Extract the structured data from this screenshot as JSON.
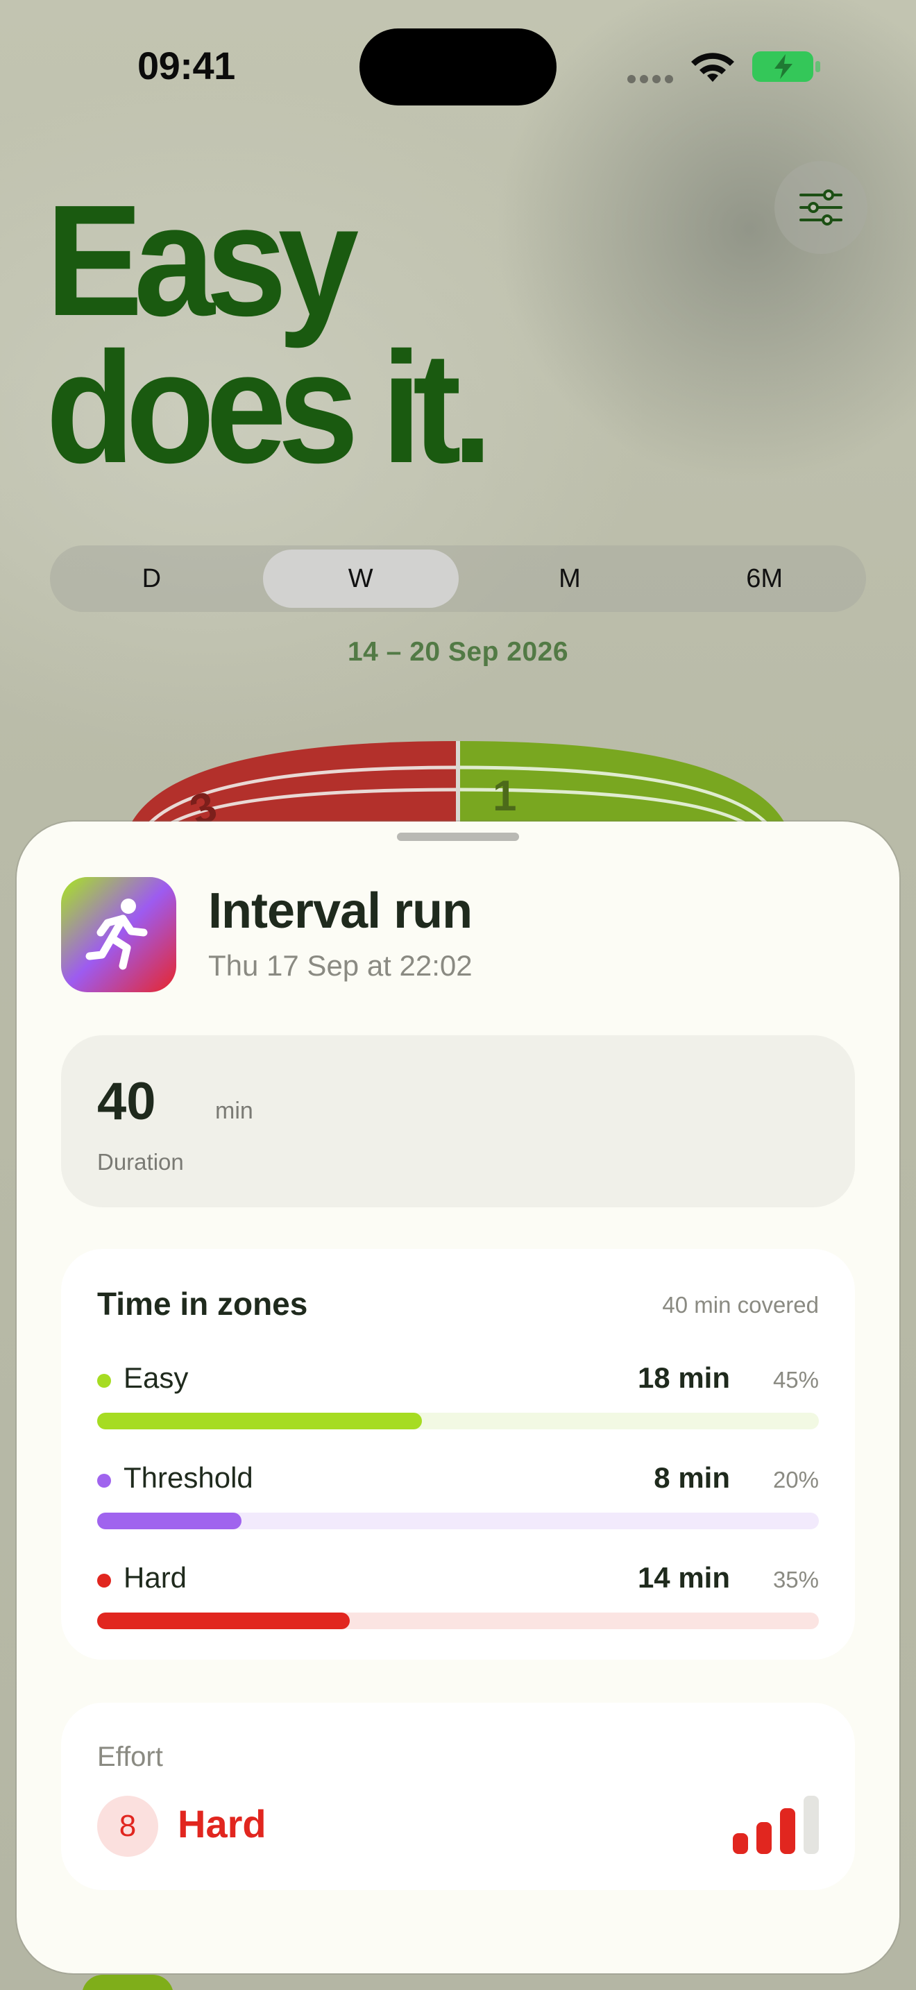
{
  "status_bar": {
    "time": "09:41"
  },
  "hero": {
    "line1": "Easy",
    "line2": "does it."
  },
  "segmented": {
    "items": [
      {
        "label": "D",
        "active": false
      },
      {
        "label": "W",
        "active": true
      },
      {
        "label": "M",
        "active": false
      },
      {
        "label": "6M",
        "active": false
      }
    ]
  },
  "date_range": "14 – 20 Sep 2026",
  "track_labels": {
    "lane_1": "1",
    "lane_3": "3"
  },
  "workout": {
    "title": "Interval run",
    "subtitle": "Thu 17 Sep at 22:02",
    "duration": {
      "value": "40",
      "unit": "min",
      "label": "Duration"
    },
    "zones": {
      "title": "Time in zones",
      "covered": "40 min covered",
      "items": [
        {
          "name": "Easy",
          "minutes": "18 min",
          "percent": "45%",
          "fraction": 0.45,
          "color": "#a6dc22",
          "track_color": "#f2f9e3"
        },
        {
          "name": "Threshold",
          "minutes": "8 min",
          "percent": "20%",
          "fraction": 0.2,
          "color": "#a064ee",
          "track_color": "#f2eafc"
        },
        {
          "name": "Hard",
          "minutes": "14 min",
          "percent": "35%",
          "fraction": 0.35,
          "color": "#e1261f",
          "track_color": "#fbe4e2"
        }
      ]
    },
    "effort": {
      "label": "Effort",
      "score": "8",
      "level": "Hard",
      "bars_filled": 3,
      "bars_total": 4
    }
  },
  "icons": {
    "filter": "sliders-icon",
    "workout": "running-figure-icon",
    "wifi": "wifi-icon",
    "battery": "battery-charging-icon"
  },
  "colors": {
    "hero_green": "#1a5a10",
    "accent_red": "#e1261f",
    "accent_green": "#a6dc22",
    "accent_purple": "#a064ee"
  }
}
